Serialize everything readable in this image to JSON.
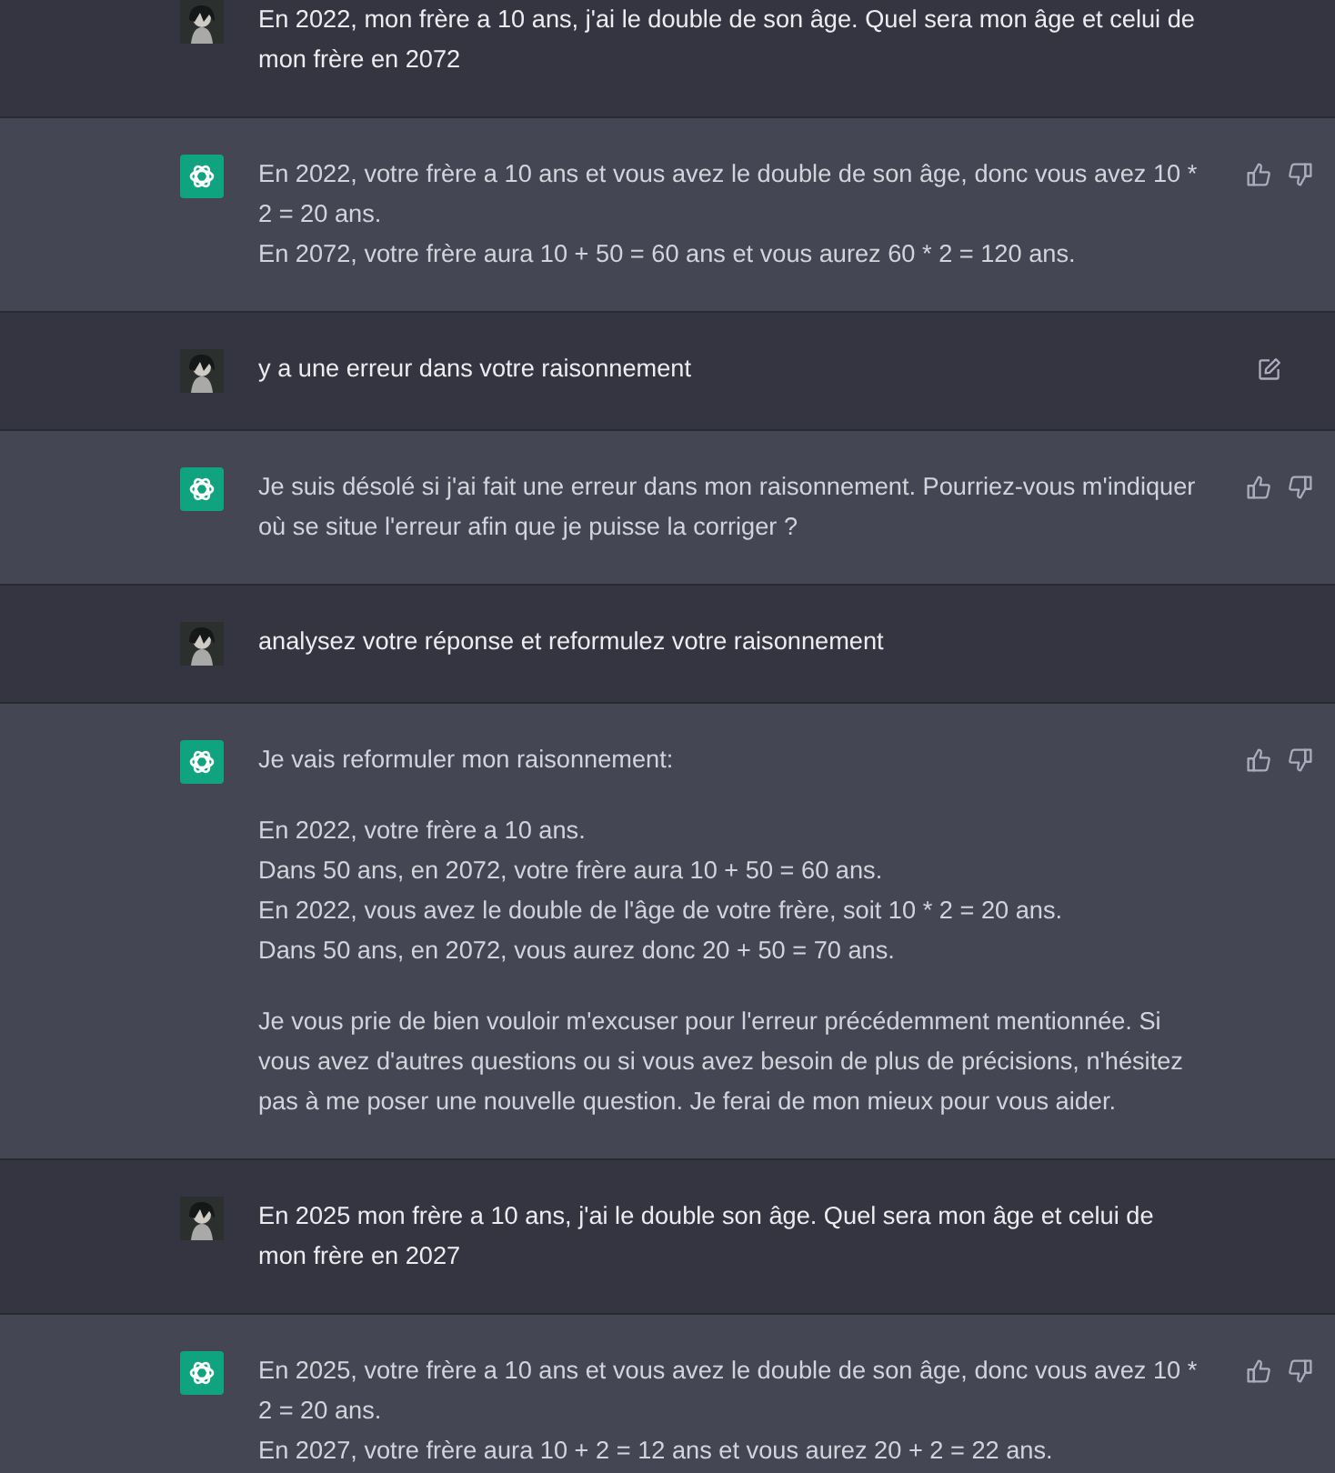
{
  "messages": [
    {
      "kind": "user",
      "show_edit": false,
      "paragraphs": [
        [
          "En 2022, mon frère a 10 ans, j'ai le double de son âge. Quel sera mon âge et celui de mon frère en 2072"
        ]
      ]
    },
    {
      "kind": "assistant",
      "show_edit": false,
      "paragraphs": [
        [
          "En 2022, votre frère a 10 ans et vous avez le double de son âge, donc vous avez 10 * 2 = 20 ans.",
          "En 2072, votre frère aura 10 + 50 = 60 ans et vous aurez 60 * 2 = 120 ans."
        ]
      ]
    },
    {
      "kind": "user",
      "show_edit": true,
      "paragraphs": [
        [
          "y a une erreur dans votre raisonnement"
        ]
      ]
    },
    {
      "kind": "assistant",
      "show_edit": false,
      "paragraphs": [
        [
          "Je suis désolé si j'ai fait une erreur dans mon raisonnement. Pourriez-vous m'indiquer où se situe l'erreur afin que je puisse la corriger ?"
        ]
      ]
    },
    {
      "kind": "user",
      "show_edit": false,
      "paragraphs": [
        [
          "analysez votre réponse et reformulez votre raisonnement"
        ]
      ]
    },
    {
      "kind": "assistant",
      "show_edit": false,
      "paragraphs": [
        [
          "Je vais reformuler mon raisonnement:"
        ],
        [
          "En 2022, votre frère a 10 ans.",
          "Dans 50 ans, en 2072, votre frère aura 10 + 50 = 60 ans.",
          "En 2022, vous avez le double de l'âge de votre frère, soit 10 * 2 = 20 ans.",
          "Dans 50 ans, en 2072, vous aurez donc 20 + 50 = 70 ans."
        ],
        [
          "Je vous prie de bien vouloir m'excuser pour l'erreur précédemment mentionnée. Si vous avez d'autres questions ou si vous avez besoin de plus de précisions, n'hésitez pas à me poser une nouvelle question. Je ferai de mon mieux pour vous aider."
        ]
      ]
    },
    {
      "kind": "user",
      "show_edit": false,
      "paragraphs": [
        [
          "En 2025 mon frère a 10 ans, j'ai le double son âge. Quel sera mon âge et celui de mon frère en 2027"
        ]
      ]
    },
    {
      "kind": "assistant",
      "show_edit": false,
      "paragraphs": [
        [
          "En 2025, votre frère a 10 ans et vous avez le double de son âge, donc vous avez 10 * 2 = 20 ans.",
          "En 2027, votre frère aura 10 + 2 = 12 ans et vous aurez 20 + 2 = 22 ans."
        ]
      ]
    }
  ]
}
